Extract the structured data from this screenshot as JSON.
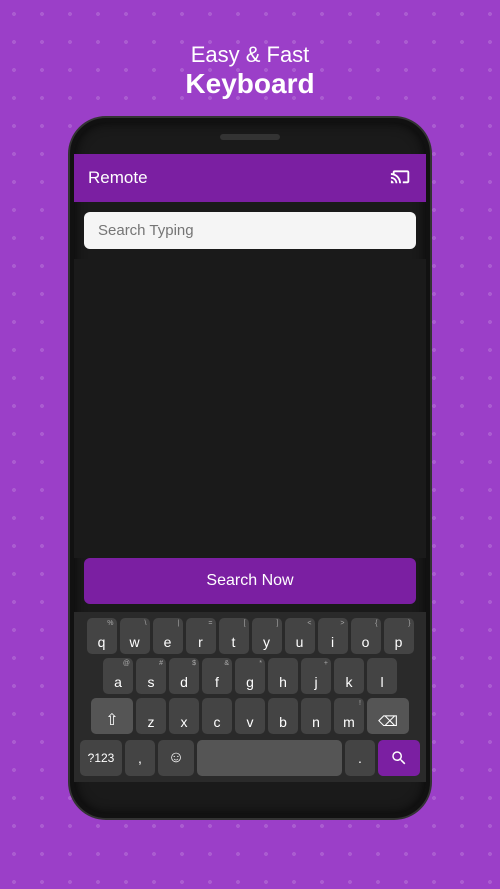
{
  "header": {
    "subtitle": "Easy & Fast",
    "title": "Keyboard"
  },
  "app": {
    "title": "Remote",
    "cast_icon": "⊡"
  },
  "search": {
    "placeholder": "Search Typing",
    "button_label": "Search Now"
  },
  "keyboard": {
    "row1": [
      {
        "char": "q",
        "top": "%"
      },
      {
        "char": "w",
        "top": "\\"
      },
      {
        "char": "e",
        "top": "|"
      },
      {
        "char": "r",
        "top": "="
      },
      {
        "char": "t",
        "top": "["
      },
      {
        "char": "y",
        "top": "]"
      },
      {
        "char": "u",
        "top": "<"
      },
      {
        "char": "i",
        "top": ">"
      },
      {
        "char": "o",
        "top": "{"
      },
      {
        "char": "p",
        "top": "}"
      }
    ],
    "row2": [
      {
        "char": "a",
        "top": "@"
      },
      {
        "char": "s",
        "top": "#"
      },
      {
        "char": "d",
        "top": "$"
      },
      {
        "char": "f",
        "top": "&"
      },
      {
        "char": "g",
        "top": "*"
      },
      {
        "char": "h",
        "top": ""
      },
      {
        "char": "j",
        "top": "+"
      },
      {
        "char": "k",
        "top": ""
      },
      {
        "char": "l",
        "top": ""
      }
    ],
    "row3": [
      {
        "char": "z",
        "top": ""
      },
      {
        "char": "x",
        "top": ""
      },
      {
        "char": "c",
        "top": ""
      },
      {
        "char": "v",
        "top": ""
      },
      {
        "char": "b",
        "top": ""
      },
      {
        "char": "n",
        "top": ""
      },
      {
        "char": "m",
        "top": "!"
      }
    ],
    "num_key": "?123",
    "period_label": ".",
    "comma_label": ","
  }
}
